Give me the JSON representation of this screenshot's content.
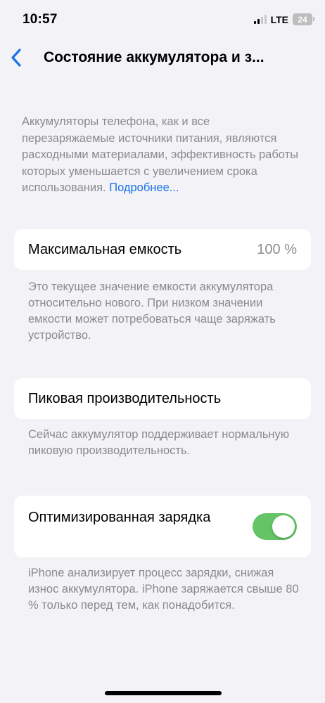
{
  "status_bar": {
    "time": "10:57",
    "network": "LTE",
    "battery": "24"
  },
  "nav": {
    "title": "Состояние аккумулятора и з..."
  },
  "intro": {
    "text": "Аккумуляторы телефона, как и все перезаряжаемые источники питания, являются расходными материалами, эффективность работы которых уменьшается с увеличением срока использования.",
    "link": "Подробнее..."
  },
  "max_capacity": {
    "label": "Максимальная емкость",
    "value": "100 %",
    "footnote": "Это текущее значение емкости аккумулятора относительно нового. При низком значении емкости может потребоваться чаще заряжать устройство."
  },
  "peak_performance": {
    "label": "Пиковая производительность",
    "footnote": "Сейчас аккумулятор поддерживает нормальную пиковую производительность."
  },
  "optimized_charging": {
    "label": "Оптимизированная зарядка",
    "enabled": true,
    "footnote": "iPhone анализирует процесс зарядки, снижая износ аккумулятора. iPhone заряжается свыше 80 % только перед тем, как понадобится."
  },
  "colors": {
    "accent": "#1a73e8",
    "toggle_on": "#65c466",
    "background": "#f2f2f7"
  }
}
